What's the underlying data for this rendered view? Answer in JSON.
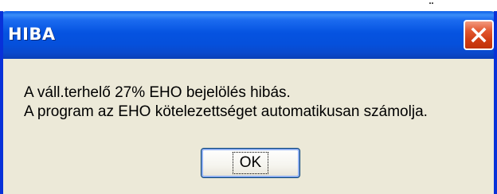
{
  "dialog": {
    "title": "HIBA",
    "close_icon": "close-x-icon",
    "message_lines": [
      "A váll.terhelő 27% EHO bejelölés hibás.",
      "A program az EHO kötelezettséget automatikusan számolja."
    ],
    "ok_label": "OK"
  },
  "colors": {
    "titlebar": "#0553e1",
    "window_frame": "#0831d9",
    "dialog_background": "#ece9d8",
    "close_button": "#e2572f"
  }
}
